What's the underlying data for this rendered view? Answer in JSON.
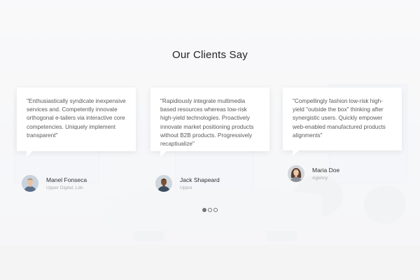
{
  "section": {
    "title": "Our Clients Say"
  },
  "testimonials": [
    {
      "quote": "\"Enthusiastically syndicate inexpensive services and. Competently innovate orthogonal e-tailers via interactive core competencies. Uniquely implement transparent\"",
      "name": "Manel Fonseca",
      "role": "Upper Digital, Ldo",
      "avatar_icon": "man-avatar-icon"
    },
    {
      "quote": "\"Rapidiously integrate multimedia based resources whereas low-risk high-yield technologies. Proactively innovate market positioning products without B2B products. Progressively recaptiualize\"",
      "name": "Jack Shapeard",
      "role": "Uppor",
      "avatar_icon": "man-avatar-icon"
    },
    {
      "quote": "\"Compellingly fashion low-risk high-yield \"outside the box\" thinking after synergistic users. Quickly empower web-enabled manufactured products alignments\"",
      "name": "Maria Doe",
      "role": "Agency",
      "avatar_icon": "woman-avatar-icon"
    }
  ],
  "pager": {
    "total": 3,
    "active": 1
  },
  "colors": {
    "title": "#222222",
    "quote_text": "#5a5a5a",
    "role_text": "#a8a8a8",
    "dot": "#777777"
  }
}
